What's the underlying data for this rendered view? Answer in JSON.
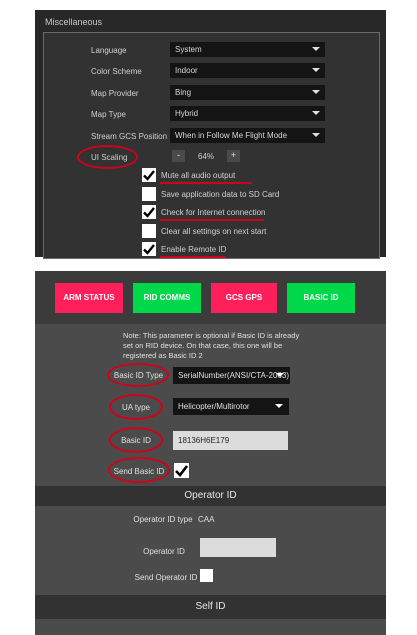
{
  "misc": {
    "title": "Miscellaneous",
    "rows": [
      {
        "label": "Language",
        "value": "System"
      },
      {
        "label": "Color Scheme",
        "value": "Indoor"
      },
      {
        "label": "Map Provider",
        "value": "Bing"
      },
      {
        "label": "Map Type",
        "value": "Hybrid"
      },
      {
        "label": "Stream GCS Position",
        "value": "When in Follow Me Flight Mode"
      }
    ],
    "ui_scaling": {
      "label": "UI Scaling",
      "minus": "-",
      "value": "64%",
      "plus": "+"
    },
    "checkboxes": [
      {
        "label": "Mute all audio output",
        "checked": true
      },
      {
        "label": "Save application data to SD Card",
        "checked": false
      },
      {
        "label": "Check for Internet connection",
        "checked": true
      },
      {
        "label": "Clear all settings on next start",
        "checked": false
      },
      {
        "label": "Enable Remote ID",
        "checked": true
      }
    ],
    "annotation_color": "#d0021b"
  },
  "remote_id": {
    "status_buttons": [
      {
        "label": "ARM STATUS",
        "color": "#ff1f5a"
      },
      {
        "label": "RID COMMS",
        "color": "#00d84a"
      },
      {
        "label": "GCS GPS",
        "color": "#ff1f5a"
      },
      {
        "label": "BASIC ID",
        "color": "#00d84a"
      }
    ],
    "note": "Note: This parameter is optional if Basic ID is already set on RID device. On that case, this one will be registered as Basic ID 2",
    "basic_id_type": {
      "label": "Basic ID Type",
      "value": "SerialNumber(ANSI/CTA-2063)"
    },
    "ua_type": {
      "label": "UA type",
      "value": "Helicopter/Multirotor"
    },
    "basic_id": {
      "label": "Basic ID",
      "value": "18136H6E179"
    },
    "send_basic_id": {
      "label": "Send Basic ID",
      "checked": true
    },
    "operator_section": {
      "title": "Operator ID",
      "type_label": "Operator ID type",
      "type_value": "CAA",
      "id_label": "Operator ID",
      "id_value": "",
      "send_label": "Send Operator ID",
      "send_checked": false
    },
    "self_id_title": "Self ID"
  }
}
